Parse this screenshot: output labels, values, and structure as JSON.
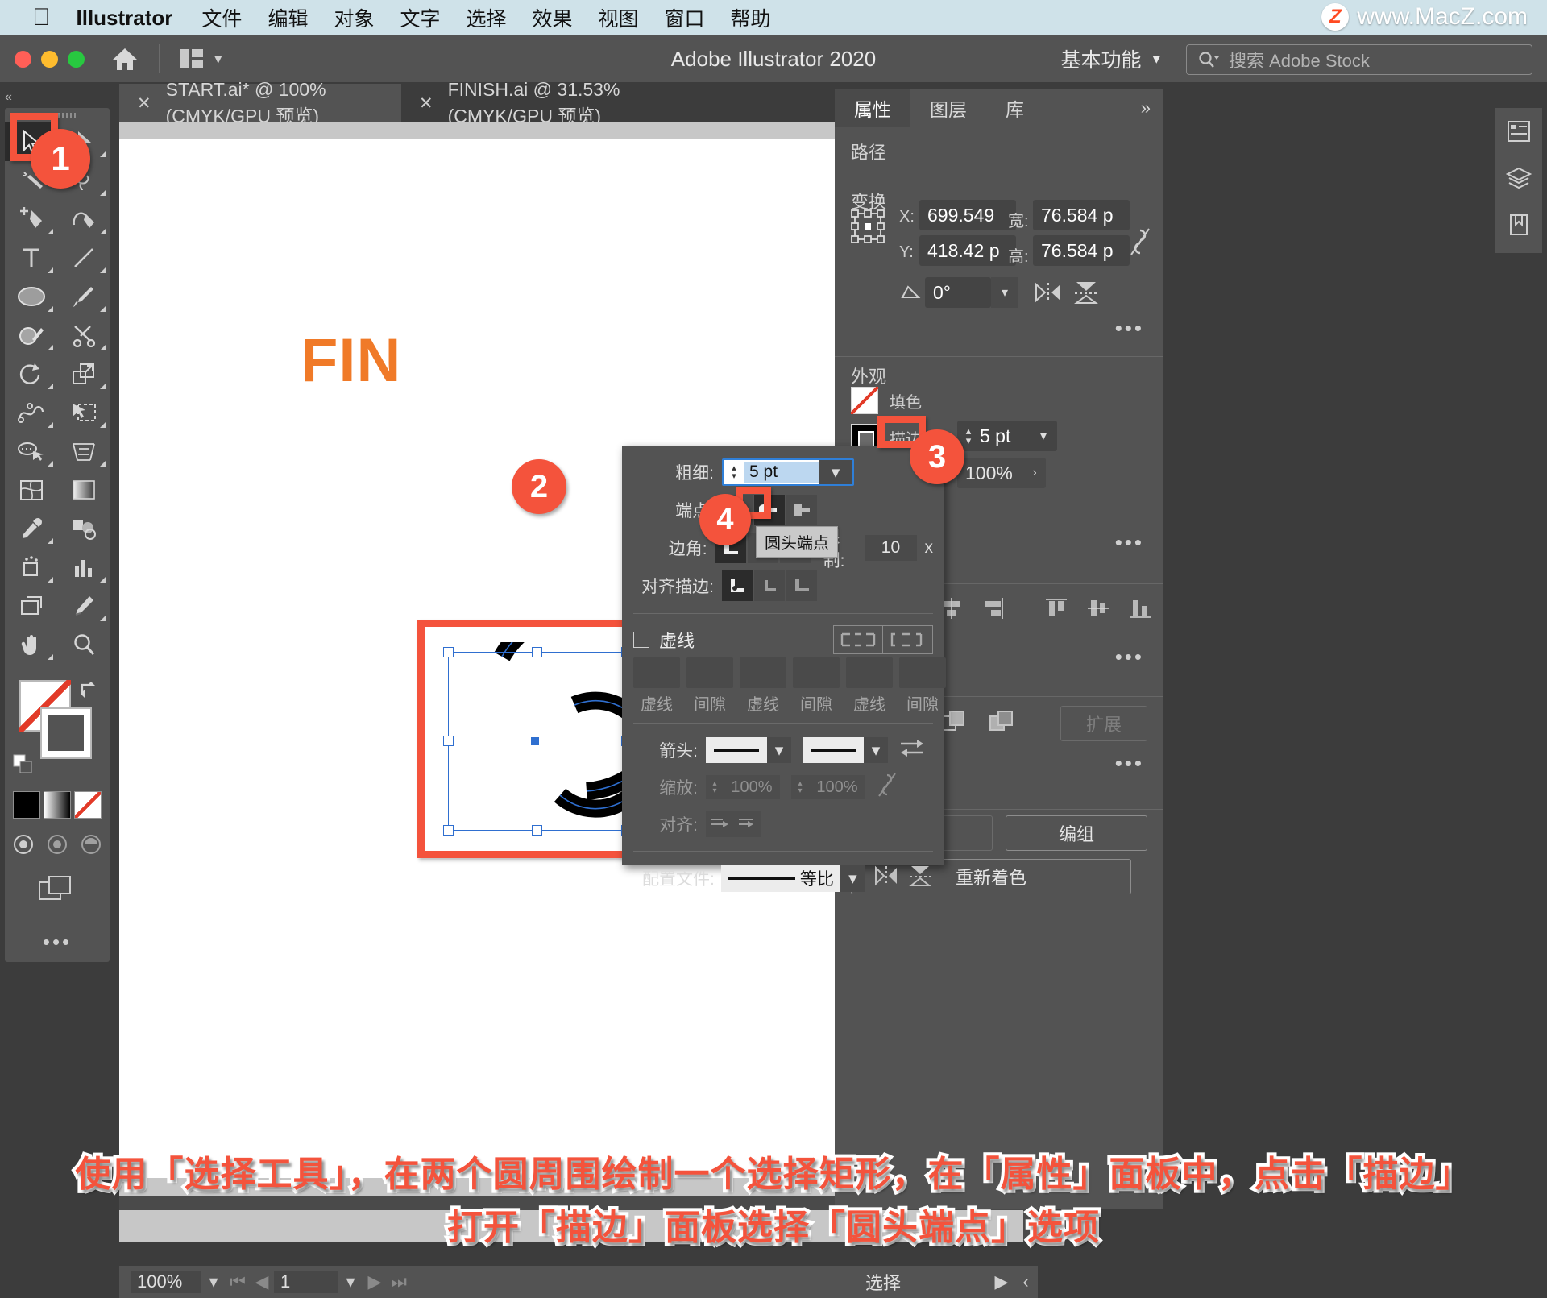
{
  "macmenu": {
    "apple": "apple-logo",
    "app": "Illustrator",
    "items": [
      "文件",
      "编辑",
      "对象",
      "文字",
      "选择",
      "效果",
      "视图",
      "窗口",
      "帮助"
    ],
    "watermark": {
      "z": "Z",
      "text": "www.MacZ.com"
    }
  },
  "titlebar": {
    "title": "Adobe Illustrator 2020",
    "workspace": "基本功能",
    "search_placeholder": "搜索 Adobe Stock"
  },
  "tabs": [
    {
      "label": "START.ai* @ 100% (CMYK/GPU 预览)",
      "active": true
    },
    {
      "label": "FINISH.ai @ 31.53% (CMYK/GPU 预览)",
      "active": false
    }
  ],
  "canvas": {
    "headline": "FIN"
  },
  "badges": {
    "one": "1",
    "two": "2",
    "three": "3",
    "four": "4"
  },
  "properties": {
    "tabs": [
      "属性",
      "图层",
      "库"
    ],
    "active_tab": "属性",
    "overflow": "»",
    "section_path": "路径",
    "section_transform": "变换",
    "transform": {
      "x_label": "X:",
      "x_value": "699.549",
      "y_label": "Y:",
      "y_value": "418.42 p",
      "w_label": "宽:",
      "w_value": "76.584 p",
      "h_label": "高:",
      "h_value": "76.584 p",
      "angle_value": "0°"
    },
    "section_appearance": "外观",
    "fill_label": "填色",
    "stroke_label": "描边",
    "stroke_weight": "5 pt",
    "opacity_value": "100%",
    "expand_button": "扩展",
    "group_button": "编组",
    "recolor_button": "重新着色",
    "more": "•••"
  },
  "stroke_panel": {
    "weight_label": "粗细:",
    "weight_value": "5 pt",
    "cap_label": "端点:",
    "corner_label": "边角:",
    "miter_label": "限制:",
    "miter_value": "10",
    "miter_unit": "x",
    "align_label": "对齐描边:",
    "dashed_label": "虚线",
    "dash_fields": [
      "虚线",
      "间隙",
      "虚线",
      "间隙",
      "虚线",
      "间隙"
    ],
    "arrow_label": "箭头:",
    "scale_label": "缩放:",
    "scale_value_1": "100%",
    "scale_value_2": "100%",
    "align_arrow_label": "对齐:",
    "profile_label": "配置文件:",
    "profile_value": "等比",
    "tooltip": "圆头端点"
  },
  "statusbar": {
    "zoom": "100%",
    "page": "1",
    "tool": "选择"
  },
  "caption": {
    "line1": "使用「选择工具」，在两个圆周围绘制一个选择矩形，在「属性」面板中，点击「描边」",
    "line2": "打开「描边」面板选择「圆头端点」选项"
  },
  "colors": {
    "accent": "#f4533c",
    "panel_bg": "#535353",
    "app_bg": "#3c3c3c",
    "menubar_bg": "#cfe2e9",
    "selection_blue": "#2f6fd0",
    "headline_orange": "#f07a28"
  }
}
